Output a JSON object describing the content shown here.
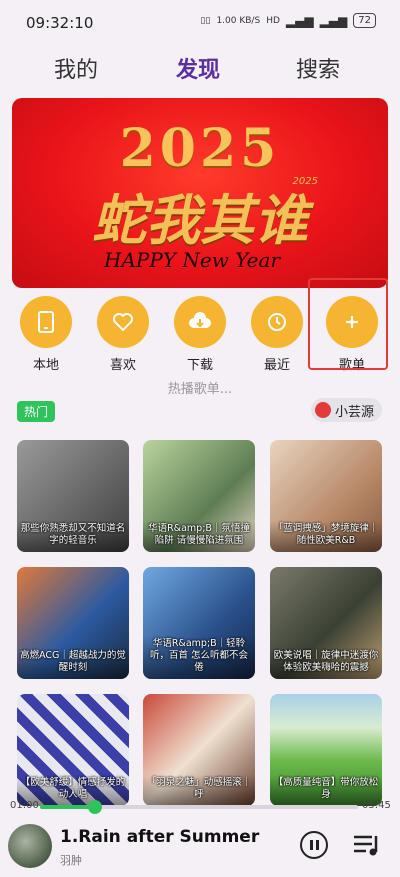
{
  "status": {
    "time": "09:32:10",
    "net_speed": "1.00 KB/S",
    "battery": "72"
  },
  "tabs": [
    {
      "label": "我的"
    },
    {
      "label": "发现",
      "active": true
    },
    {
      "label": "搜索"
    }
  ],
  "banner": {
    "year": "2025",
    "text_cn": "蛇我其谁",
    "text_en": "HAPPY New Year",
    "small_year": "2025"
  },
  "quick_actions": [
    {
      "label": "本地",
      "icon": "tablet-icon"
    },
    {
      "label": "喜欢",
      "icon": "heart-icon"
    },
    {
      "label": "下载",
      "icon": "cloud-download-icon"
    },
    {
      "label": "最近",
      "icon": "history-icon"
    },
    {
      "label": "歌单",
      "icon": "plus-icon"
    }
  ],
  "hot_hint": "热播歌单...",
  "hot_badge": "热门",
  "source_label": "小芸源",
  "playlists": [
    {
      "caption": "那些你熟悉却又不知道名字的轻音乐",
      "color": "#6b6b6b"
    },
    {
      "caption": "华语R&amp;B｜氛悟撞陷阱 请慢慢陷进氛围",
      "color": "#8fb27a"
    },
    {
      "caption": "「蓝调拽感」梦境旋律｜随性欧美R&B",
      "color": "#c9a07a"
    },
    {
      "caption": "高燃ACG｜超越战力的觉醒时刻",
      "color": "#3a6fb0"
    },
    {
      "caption": "华语R&amp;B｜轻聆听，百首 怎么听都不会倦",
      "color": "#3a5f95"
    },
    {
      "caption": "欧美说唱｜旋律中迷渡你体验欧美嗨哈的震撼",
      "color": "#4f5a4a"
    },
    {
      "caption": "【欧美舒缓】情感抒发的动人唱",
      "color": "#5a5fb5"
    },
    {
      "caption": "「羽泉之魅」动感摇滚｜呼",
      "color": "#8a6048"
    },
    {
      "caption": "【高质量纯音】带你放松身",
      "color": "#6aa84a"
    }
  ],
  "player": {
    "time_current": "01:00",
    "time_total": "05:45",
    "progress": 0.174,
    "title": "1.Rain after Summer",
    "artist": "羽肿"
  }
}
